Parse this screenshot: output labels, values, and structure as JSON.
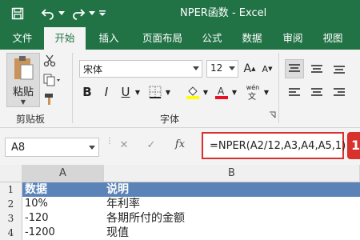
{
  "title": "NPER函数 - Excel",
  "tabs": [
    {
      "label": "文件",
      "active": false
    },
    {
      "label": "开始",
      "active": true
    },
    {
      "label": "插入",
      "active": false
    },
    {
      "label": "页面布局",
      "active": false
    },
    {
      "label": "公式",
      "active": false
    },
    {
      "label": "数据",
      "active": false
    },
    {
      "label": "审阅",
      "active": false
    },
    {
      "label": "视图",
      "active": false
    }
  ],
  "ribbon": {
    "paste_label": "粘贴",
    "clipboard_label": "剪贴板",
    "font_name": "宋体",
    "font_size": "12",
    "font_group_label": "字体",
    "bold": "B",
    "italic": "I",
    "underline": "U",
    "grow_font": "A",
    "shrink_font": "A",
    "phonetic": "wén"
  },
  "formula_bar": {
    "name_box": "A8",
    "cancel": "✕",
    "enter": "✓",
    "fx": "fx",
    "formula": "=NPER(A2/12,A3,A4,A5,1)",
    "badge": "1"
  },
  "sheet": {
    "columns": [
      "A",
      "B"
    ],
    "rows": [
      {
        "num": "1",
        "a": "数据",
        "b": "说明",
        "header": true
      },
      {
        "num": "2",
        "a": "10%",
        "b": "年利率",
        "header": false
      },
      {
        "num": "3",
        "a": "-120",
        "b": "各期所付的金额",
        "header": false
      },
      {
        "num": "4",
        "a": "-1200",
        "b": "现值",
        "header": false
      }
    ]
  },
  "colors": {
    "excel_green": "#217346",
    "header_blue": "#5b83b7",
    "highlight_red": "#d9312b"
  }
}
